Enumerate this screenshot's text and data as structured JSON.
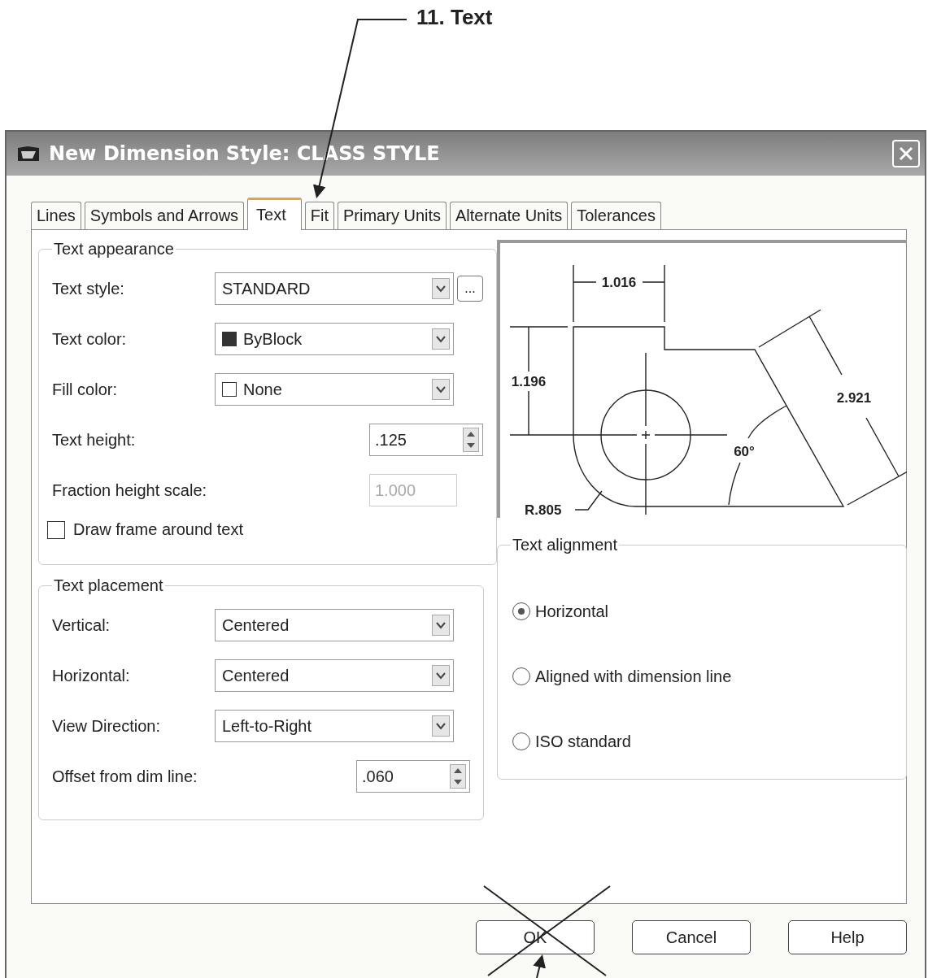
{
  "annotation": {
    "label": "11. Text"
  },
  "window": {
    "title": "New Dimension Style: CLASS STYLE"
  },
  "tabs": [
    {
      "label": "Lines",
      "selected": false
    },
    {
      "label": "Symbols and Arrows",
      "selected": false
    },
    {
      "label": "Text",
      "selected": true
    },
    {
      "label": "Fit",
      "selected": false
    },
    {
      "label": "Primary Units",
      "selected": false
    },
    {
      "label": "Alternate Units",
      "selected": false
    },
    {
      "label": "Tolerances",
      "selected": false
    }
  ],
  "text_appearance": {
    "title": "Text appearance",
    "fields": [
      {
        "kind": "dropdown",
        "label": "Text style:",
        "value": "STANDARD",
        "button": "..."
      },
      {
        "kind": "dropdown",
        "label": "Text color:",
        "value": "ByBlock",
        "swatch_filled": true
      },
      {
        "kind": "dropdown",
        "label": "Fill color:",
        "value": "None",
        "swatch_filled": false
      },
      {
        "kind": "spinner",
        "label": "Text height:",
        "value": ".125"
      },
      {
        "kind": "textbox",
        "label": "Fraction height scale:",
        "value": "1.000",
        "disabled": true
      }
    ],
    "checkbox": {
      "label": "Draw frame around text",
      "checked": false
    }
  },
  "text_placement": {
    "title": "Text placement",
    "fields": [
      {
        "kind": "dropdown",
        "label": "Vertical:",
        "value": "Centered"
      },
      {
        "kind": "dropdown",
        "label": "Horizontal:",
        "value": "Centered"
      },
      {
        "kind": "dropdown",
        "label": "View Direction:",
        "value": "Left-to-Right"
      },
      {
        "kind": "spinner",
        "label": "Offset from dim line:",
        "value": ".060"
      }
    ]
  },
  "preview": {
    "labels": [
      "1.016",
      "1.196",
      "2.921",
      "60°",
      "R.805"
    ]
  },
  "text_alignment": {
    "title": "Text alignment",
    "options": [
      {
        "label": "Horizontal",
        "selected": true
      },
      {
        "label": "Aligned with dimension line",
        "selected": false
      },
      {
        "label": "ISO standard",
        "selected": false
      }
    ]
  },
  "buttons": [
    "OK",
    "Cancel",
    "Help"
  ]
}
